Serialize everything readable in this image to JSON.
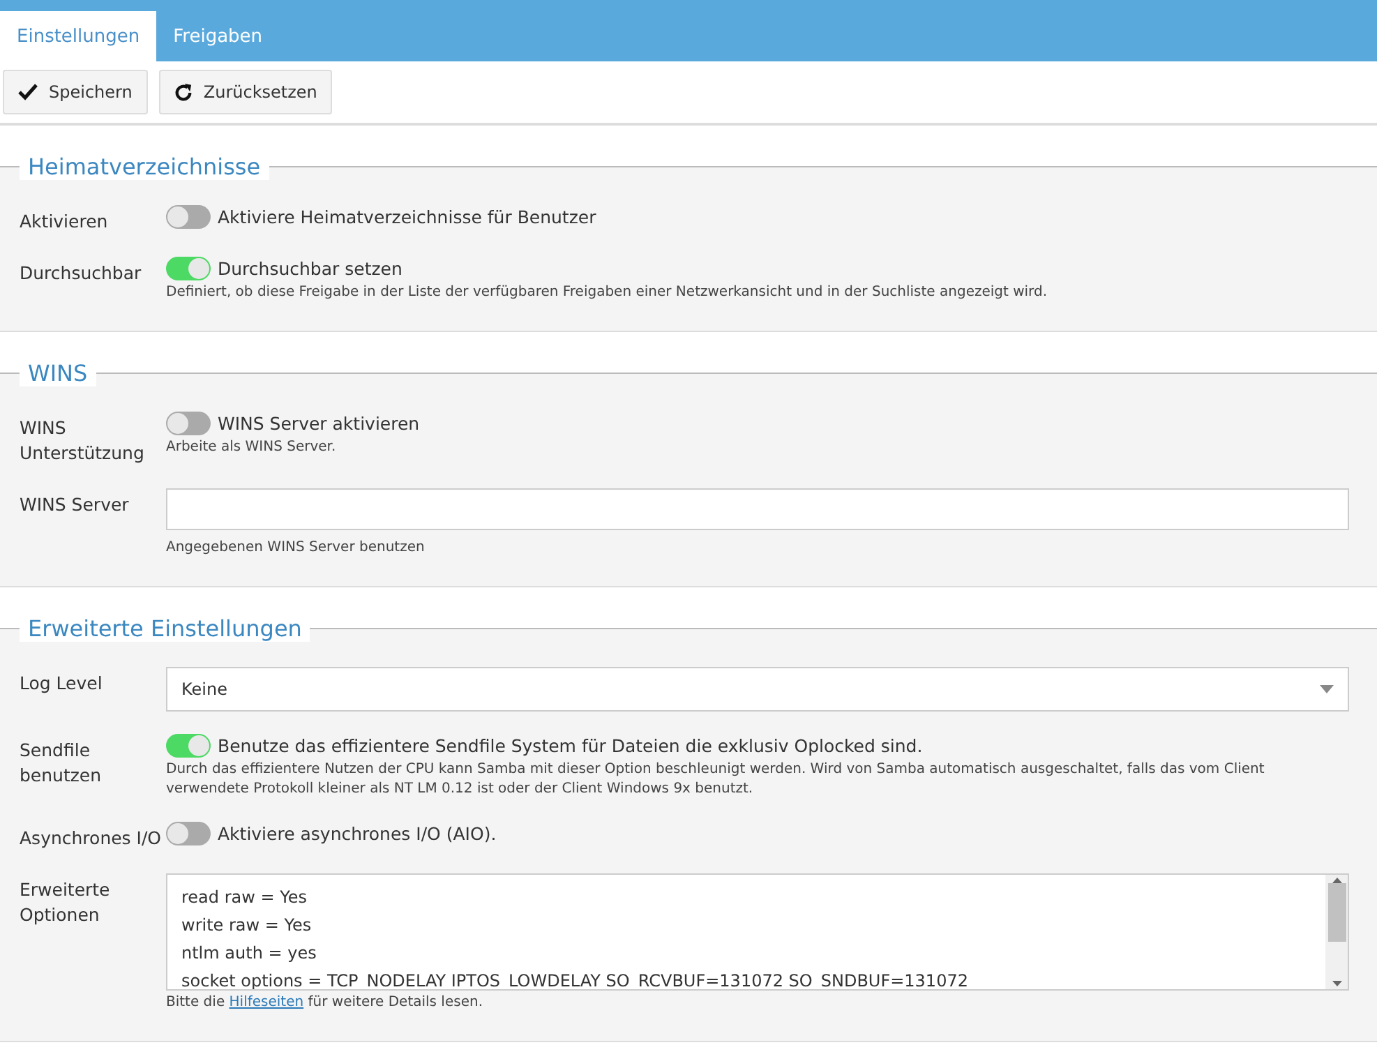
{
  "tabs": [
    {
      "label": "Einstellungen",
      "selected": true
    },
    {
      "label": "Freigaben",
      "selected": false
    }
  ],
  "toolbar": [
    {
      "label": "Speichern",
      "kind": "save"
    },
    {
      "label": "Zurücksetzen",
      "kind": "reset"
    }
  ],
  "sections": [
    {
      "title": "Heimatverzeichnisse",
      "rows": [
        {
          "kind": "toggle",
          "label": "Aktivieren",
          "on": false,
          "text": "Aktiviere Heimatverzeichnisse für Benutzer"
        },
        {
          "kind": "toggle",
          "label": "Durchsuchbar",
          "on": true,
          "text": "Durchsuchbar setzen",
          "hint": "Definiert, ob diese Freigabe in der Liste der verfügbaren Freigaben einer Netzwerkansicht und in der Suchliste angezeigt wird."
        }
      ]
    },
    {
      "title": "WINS",
      "rows": [
        {
          "kind": "toggle",
          "label": "WINS Unterstützung",
          "on": false,
          "text": "WINS Server aktivieren",
          "hint": "Arbeite als WINS Server."
        },
        {
          "kind": "input",
          "label": "WINS Server",
          "hint": "Angegebenen WINS Server benutzen"
        }
      ]
    },
    {
      "title": "Erweiterte Einstellungen",
      "rows": [
        {
          "kind": "select",
          "label": "Log Level",
          "value": "Keine"
        },
        {
          "kind": "toggle",
          "label": "Sendfile benutzen",
          "on": true,
          "text": "Benutze das effizientere Sendfile System für Dateien die exklusiv Oplocked sind.",
          "hint": "Durch das effizientere Nutzen der CPU kann Samba mit dieser Option beschleunigt werden. Wird von Samba automatisch ausgeschaltet, falls das vom Client verwendete Protokoll kleiner als NT LM 0.12 ist oder der Client Windows 9x benutzt."
        },
        {
          "kind": "toggle",
          "label": "Asynchrones I/O",
          "on": false,
          "text": "Aktiviere asynchrones I/O (AIO)."
        },
        {
          "kind": "textarea",
          "label": "Erweiterte Optionen",
          "lines": [
            "read raw = Yes",
            "write raw = Yes",
            "ntlm auth = yes",
            "socket options = TCP_NODELAY IPTOS_LOWDELAY SO_RCVBUF=131072 SO_SNDBUF=131072"
          ],
          "hint_before": "Bitte die",
          "hint_link": "Hilfeseiten",
          "hint_after": "für weitere Details lesen."
        }
      ]
    }
  ]
}
